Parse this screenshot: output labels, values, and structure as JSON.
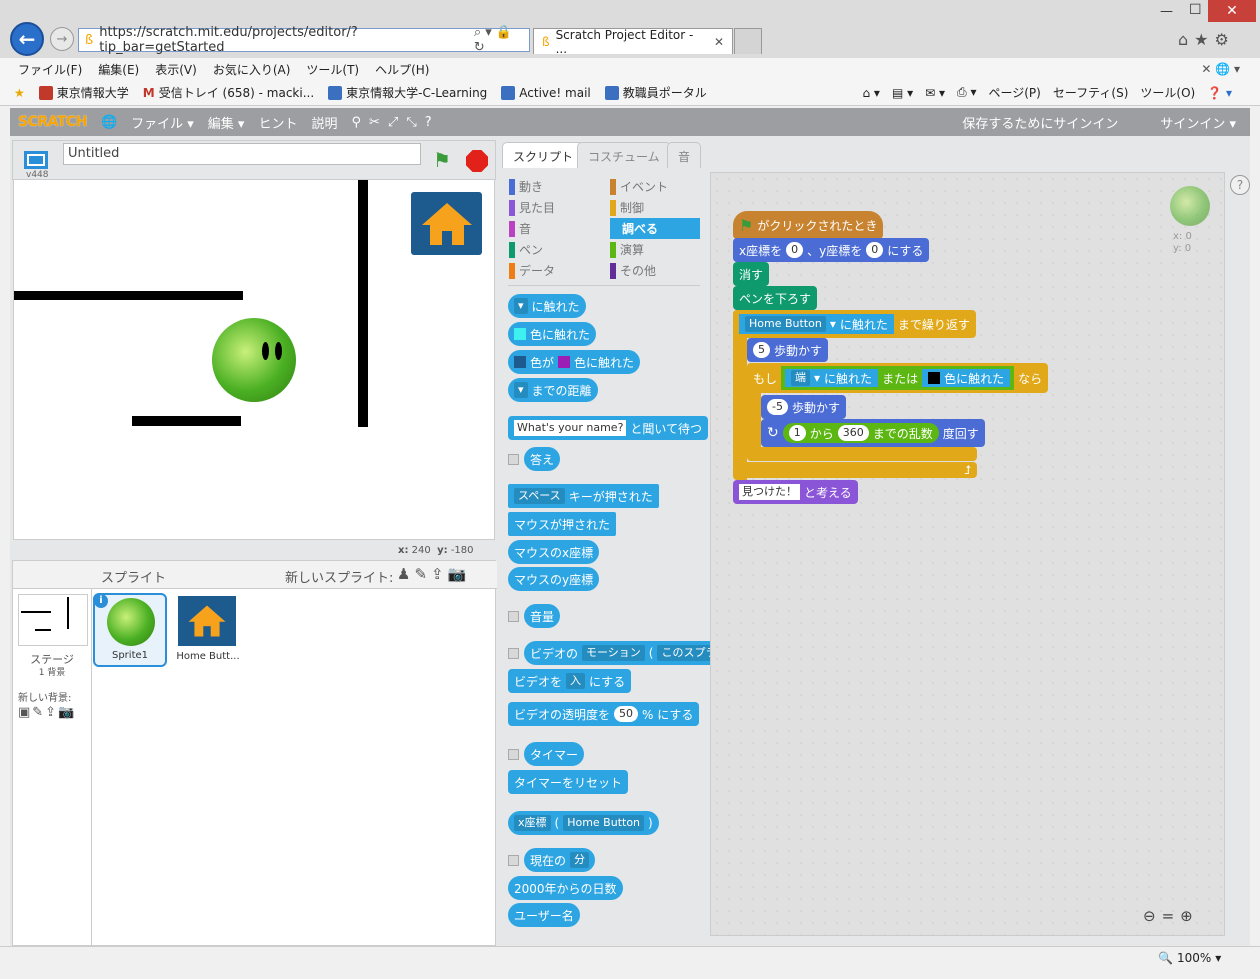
{
  "browser": {
    "url": "https://scratch.mit.edu/projects/editor/?tip_bar=getStarted",
    "tab_title": "Scratch Project Editor - ...",
    "menu": [
      "ファイル(F)",
      "編集(E)",
      "表示(V)",
      "お気に入り(A)",
      "ツール(T)",
      "ヘルプ(H)"
    ],
    "favorites": [
      "東京情報大学",
      "受信トレイ (658) - macki...",
      "東京情報大学-C-Learning",
      "Active! mail",
      "教職員ポータル"
    ],
    "right_tools": [
      "ページ(P)",
      "セーフティ(S)",
      "ツール(O)"
    ],
    "zoom": "100%"
  },
  "scratch": {
    "logo": "SCRATCH",
    "menu": [
      "ファイル ▾",
      "編集 ▾",
      "ヒント",
      "説明"
    ],
    "save_prompt": "保存するためにサインイン",
    "signin": "サインイン ▾",
    "project_title": "Untitled",
    "version": "v448",
    "stage_coords": {
      "x_label": "x:",
      "x": "240",
      "y_label": "y:",
      "y": "-180"
    },
    "sprites_header": "スプライト",
    "new_sprite": "新しいスプライト:",
    "stage_label": "ステージ",
    "backdrop_count": "1 背景",
    "new_backdrop": "新しい背景:",
    "sprites": [
      "Sprite1",
      "Home Butt..."
    ],
    "tabs": [
      "スクリプト",
      "コスチューム",
      "音"
    ],
    "categories_left": [
      "動き",
      "見た目",
      "音",
      "ペン",
      "データ"
    ],
    "categories_right": [
      "イベント",
      "制御",
      "調べる",
      "演算",
      "その他"
    ],
    "palette": {
      "touching": "に触れた",
      "touching_color": "色に触れた",
      "color_is": "色が",
      "distance": "までの距離",
      "ask_text": "What's your name?",
      "ask_wait": "と聞いて待つ",
      "answer": "答え",
      "space": "スペース",
      "key_pressed": "キーが押された",
      "mouse_down": "マウスが押された",
      "mouse_x": "マウスのx座標",
      "mouse_y": "マウスのy座標",
      "loudness": "音量",
      "video": "ビデオの",
      "motion": "モーション",
      "this_sprite": "このスプラ",
      "video_to": "ビデオを",
      "on": "入",
      "set_to": "にする",
      "transparency": "ビデオの透明度を",
      "fifty": "50",
      "percent_set": "% にする",
      "timer": "タイマー",
      "reset_timer": "タイマーをリセット",
      "x_pos": "x座標",
      "home_button": "Home Button",
      "current": "現在の",
      "minute": "分",
      "days_since": "2000年からの日数",
      "username": "ユーザー名"
    },
    "script": {
      "hat": "がクリックされたとき",
      "goto_a": "x座標を",
      "goto_b": "、y座標を",
      "goto_c": "にする",
      "zero": "0",
      "clear": "消す",
      "pen_down": "ペンを下ろす",
      "target": "Home Button",
      "touched": "に触れた",
      "repeat_until": "まで繰り返す",
      "five": "5",
      "move": "歩動かす",
      "if": "もし",
      "edge": "端",
      "or": "または",
      "color_touch": "色に触れた",
      "then": "なら",
      "minus5": "-5",
      "one": "1",
      "from": "から",
      "n360": "360",
      "random": "までの乱数",
      "turn": "度回す",
      "found": "見つけた！",
      "think": "と考える"
    },
    "sprite_info": {
      "x": "x: 0",
      "y": "y: 0"
    }
  }
}
